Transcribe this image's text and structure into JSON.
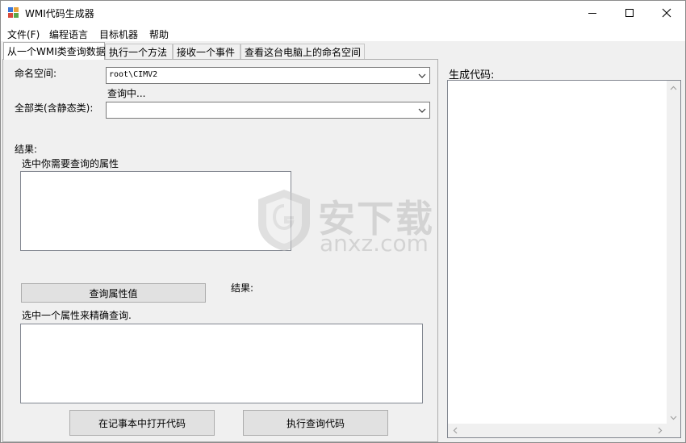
{
  "window": {
    "title": "WMI代码生成器",
    "icon": "app-window-icon"
  },
  "menu": {
    "items": [
      "文件(F)",
      "编程语言",
      "目标机器",
      "帮助"
    ]
  },
  "tabs": [
    {
      "label": "从一个WMI类查询数据",
      "active": true
    },
    {
      "label": "执行一个方法",
      "active": false
    },
    {
      "label": "接收一个事件",
      "active": false
    },
    {
      "label": "查看这台电脑上的命名空间",
      "active": false
    }
  ],
  "query_tab": {
    "namespace_label": "命名空间:",
    "namespace_value": "root\\CIMV2",
    "status_text": "查询中...",
    "classes_label": "全部类(含静态类):",
    "classes_value": "",
    "results_label": "结果:",
    "select_props_label": "选中你需要查询的属性",
    "query_values_button": "查询属性值",
    "results_label_2": "结果:",
    "refine_label": "选中一个属性来精确查询.",
    "open_notepad_button": "在记事本中打开代码",
    "execute_button": "执行查询代码"
  },
  "code_panel": {
    "title": "生成代码:"
  },
  "watermark": {
    "cn": "安下载",
    "en": "anxz.com"
  },
  "colors": {
    "window_bg": "#f0f0f0",
    "button_bg": "#e1e1e1",
    "border": "#adadad"
  }
}
